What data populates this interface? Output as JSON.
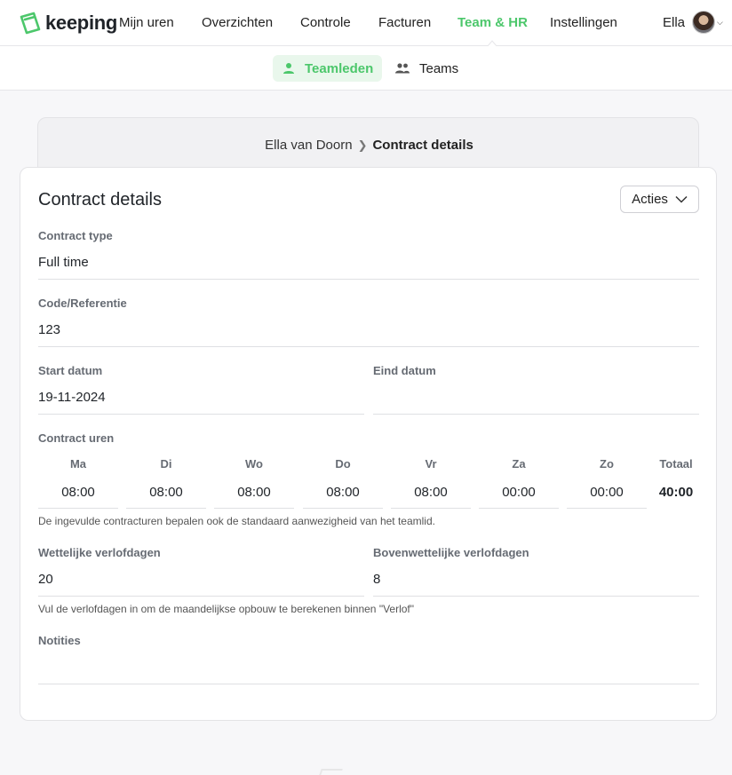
{
  "app": {
    "logo_text": "keeping",
    "logo_icon": "keeping-logo-icon"
  },
  "nav": {
    "items": [
      {
        "label": "Mijn uren"
      },
      {
        "label": "Overzichten"
      },
      {
        "label": "Controle"
      },
      {
        "label": "Facturen"
      },
      {
        "label": "Team & HR",
        "active": true
      },
      {
        "label": "Instellingen"
      }
    ],
    "user_name": "Ella",
    "accent_color": "#4cc76b"
  },
  "subnav": {
    "tabs": [
      {
        "label": "Teamleden",
        "icon": "person-icon",
        "active": true
      },
      {
        "label": "Teams",
        "icon": "people-icon"
      }
    ]
  },
  "breadcrumb": {
    "parent": "Ella van Doorn",
    "current": "Contract details"
  },
  "contract": {
    "title": "Contract details",
    "actions_label": "Acties",
    "type_label": "Contract type",
    "type_value": "Full time",
    "code_label": "Code/Referentie",
    "code_value": "123",
    "start_label": "Start datum",
    "start_value": "19-11-2024",
    "end_label": "Eind datum",
    "end_value": "",
    "hours_label": "Contract uren",
    "days": [
      {
        "label": "Ma",
        "value": "08:00"
      },
      {
        "label": "Di",
        "value": "08:00"
      },
      {
        "label": "Wo",
        "value": "08:00"
      },
      {
        "label": "Do",
        "value": "08:00"
      },
      {
        "label": "Vr",
        "value": "08:00"
      },
      {
        "label": "Za",
        "value": "00:00"
      },
      {
        "label": "Zo",
        "value": "00:00"
      }
    ],
    "total_label": "Totaal",
    "total_value": "40:00",
    "hours_hint": "De ingevulde contracturen bepalen ook de standaard aanwezigheid van het teamlid.",
    "legal_leave_label": "Wettelijke verlofdagen",
    "legal_leave_value": "20",
    "extra_leave_label": "Bovenwettelijke verlofdagen",
    "extra_leave_value": "8",
    "leave_hint": "Vul de verlofdagen in om de maandelijkse opbouw te berekenen binnen \"Verlof\"",
    "notes_label": "Notities",
    "notes_value": ""
  }
}
